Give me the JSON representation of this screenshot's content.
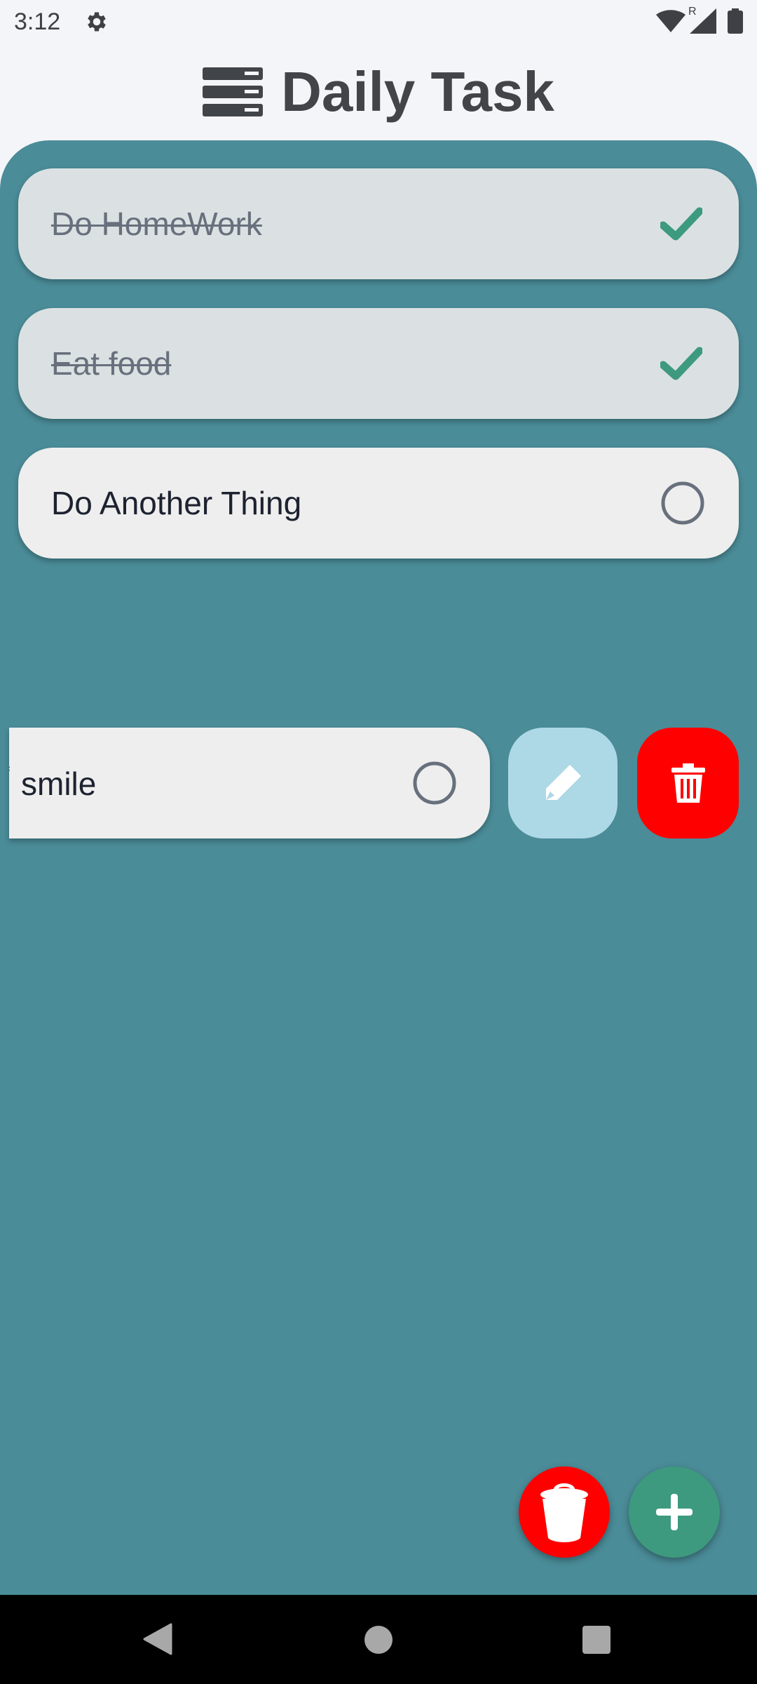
{
  "status_bar": {
    "time": "3:12",
    "roaming_indicator": "R",
    "icons": [
      "settings-gear-icon",
      "wifi-icon",
      "cell-signal-icon",
      "battery-icon"
    ]
  },
  "header": {
    "logo_icon": "task-list-logo-icon",
    "title": "Daily Task"
  },
  "tasks": [
    {
      "label": "Do HomeWork",
      "done": true,
      "status_icon": "check-icon"
    },
    {
      "label": "Eat food",
      "done": true,
      "status_icon": "check-icon"
    },
    {
      "label": "Do Another Thing",
      "done": false,
      "status_icon": "circle-icon"
    },
    {
      "label": "smile",
      "prefix_fragment": "f",
      "done": false,
      "status_icon": "circle-icon",
      "swiped": true
    }
  ],
  "swipe_actions": {
    "edit_icon": "pencil-icon",
    "delete_icon": "trash-icon"
  },
  "fabs": {
    "clear_all_icon": "trash-bin-icon",
    "add_icon": "plus-icon"
  },
  "colors": {
    "panel": "#4a8c98",
    "done_task_bg": "#dbe1e2",
    "todo_task_bg": "#eeeeee",
    "check": "#3d9a7e",
    "edit_action": "#add8e6",
    "delete_action": "#ff0000",
    "add_fab": "#3d9a7e"
  }
}
